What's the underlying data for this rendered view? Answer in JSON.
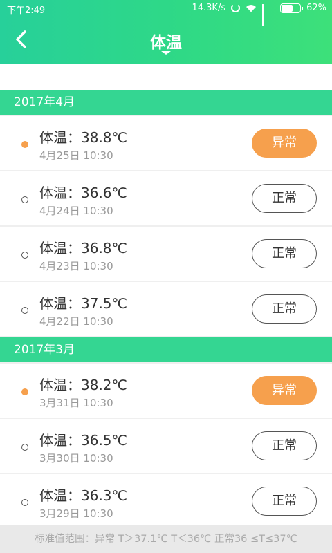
{
  "status_bar": {
    "time": "下午2:49",
    "speed": "14.3K/s",
    "battery": "62%",
    "battery_level": 0.62
  },
  "nav": {
    "title": "体温"
  },
  "months": [
    {
      "label": "2017年4月",
      "records": [
        {
          "temp": "体温：38.8℃",
          "date": "4月25日  10:30",
          "status": "异常",
          "state": "abnormal"
        },
        {
          "temp": "体温：36.6℃",
          "date": "4月24日  10:30",
          "status": "正常",
          "state": "normal"
        },
        {
          "temp": "体温：36.8℃",
          "date": "4月23日  10:30",
          "status": "正常",
          "state": "normal"
        },
        {
          "temp": "体温：37.5℃",
          "date": "4月22日  10:30",
          "status": "正常",
          "state": "normal"
        }
      ]
    },
    {
      "label": "2017年3月",
      "records": [
        {
          "temp": "体温：38.2℃",
          "date": "3月31日  10:30",
          "status": "异常",
          "state": "abnormal"
        },
        {
          "temp": "体温：36.5℃",
          "date": "3月30日  10:30",
          "status": "正常",
          "state": "normal"
        },
        {
          "temp": "体温：36.3℃",
          "date": "3月29日  10:30",
          "status": "正常",
          "state": "normal"
        }
      ]
    }
  ],
  "footer": {
    "text": "标准值范围：异常 T＞37.1℃  T＜36℃    正常36 ≤T≤37℃"
  },
  "colors": {
    "header": "#2fd986",
    "month_bar": "#34d692",
    "abnormal": "#f6a04d"
  }
}
